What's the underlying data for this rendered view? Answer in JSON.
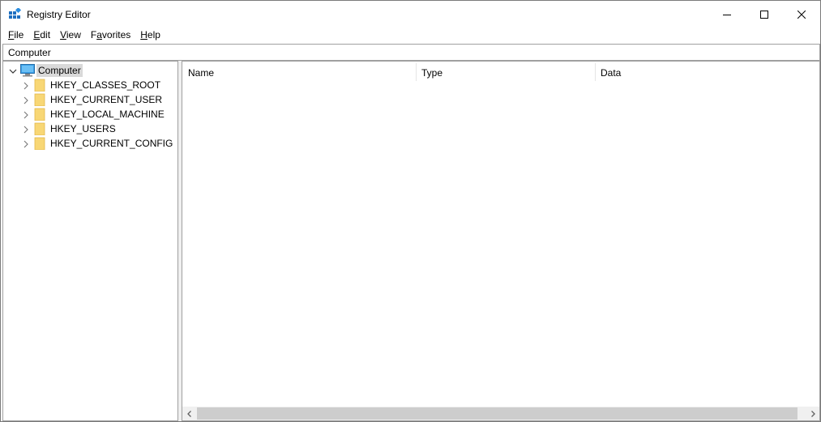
{
  "window": {
    "title": "Registry Editor"
  },
  "menu": [
    {
      "label": "File",
      "mnemonic": "F",
      "rest": "ile"
    },
    {
      "label": "Edit",
      "mnemonic": "E",
      "rest": "dit"
    },
    {
      "label": "View",
      "mnemonic": "V",
      "rest": "iew"
    },
    {
      "label": "Favorites",
      "mnemonic": "a",
      "prefix": "F",
      "rest": "vorites"
    },
    {
      "label": "Help",
      "mnemonic": "H",
      "rest": "elp"
    }
  ],
  "address": {
    "path": "Computer"
  },
  "tree": {
    "root": {
      "label": "Computer",
      "icon": "computer-icon",
      "expanded": true,
      "selected": true
    },
    "children": [
      {
        "label": "HKEY_CLASSES_ROOT",
        "icon": "folder-icon"
      },
      {
        "label": "HKEY_CURRENT_USER",
        "icon": "folder-icon"
      },
      {
        "label": "HKEY_LOCAL_MACHINE",
        "icon": "folder-icon"
      },
      {
        "label": "HKEY_USERS",
        "icon": "folder-icon"
      },
      {
        "label": "HKEY_CURRENT_CONFIG",
        "icon": "folder-icon"
      }
    ]
  },
  "list": {
    "columns": [
      "Name",
      "Type",
      "Data"
    ],
    "rows": []
  },
  "colors": {
    "folder": "#f8d775",
    "selection": "#d9d9d9",
    "scroll_thumb": "#cdcdcd"
  }
}
